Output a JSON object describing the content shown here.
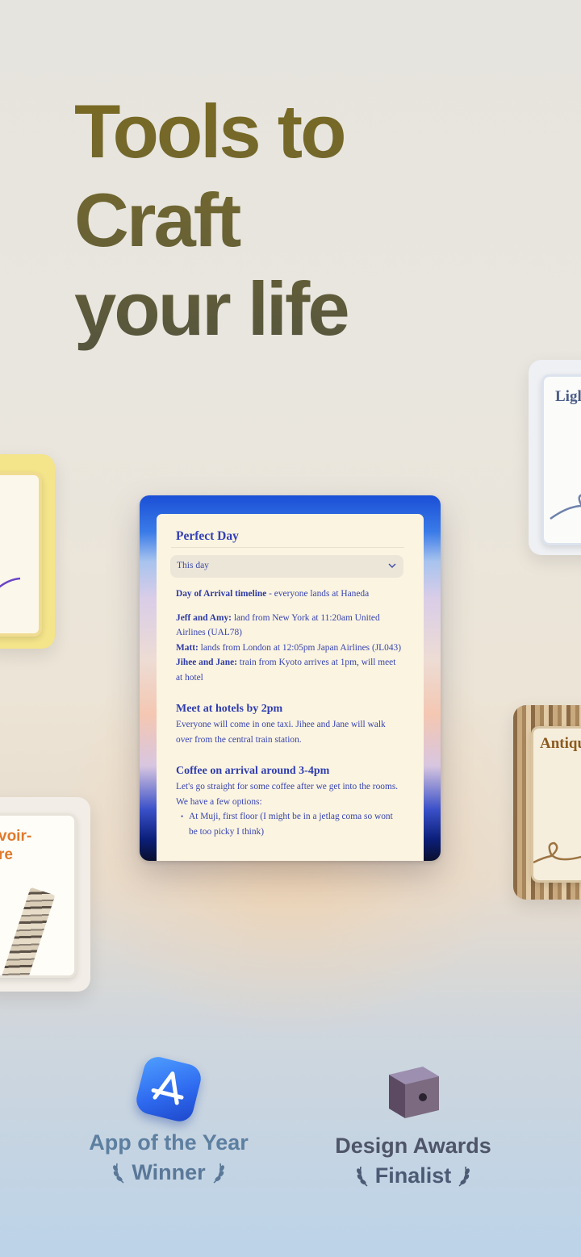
{
  "headline": {
    "line1": "Tools to",
    "line2": "Craft",
    "line3": "your life"
  },
  "side_cards": {
    "right_top_title": "Ligl",
    "left_bottom_title": "voir-\nre",
    "right_bottom_title": "Antiqu"
  },
  "document": {
    "title": "Perfect Day",
    "select_value": "This day",
    "timeline_heading": "Day of Arrival timeline",
    "timeline_rest": " - everyone lands at Haneda",
    "arrivals": [
      {
        "who": "Jeff and Amy:",
        "text": " land from New York at 11:20am United Airlines (UAL78)"
      },
      {
        "who": "Matt:",
        "text": " lands from London at 12:05pm Japan Airlines (JL043)"
      },
      {
        "who": "Jihee and Jane:",
        "text": " train from Kyoto arrives at 1pm, will meet at hotel"
      }
    ],
    "section1_heading": "Meet at hotels by 2pm",
    "section1_text": "Everyone will come in one taxi. Jihee and Jane will walk over from the central train station.",
    "section2_heading": "Coffee on arrival around 3-4pm",
    "section2_text": "Let's go straight for some coffee after we get into the rooms. We have a few options:",
    "section2_bullet": "At Muji, first floor (I might be in a jetlag coma so wont be too picky I think)"
  },
  "awards": [
    {
      "title": "App of the Year",
      "subtitle": "Winner",
      "icon": "app-store-icon"
    },
    {
      "title": "Design Awards",
      "subtitle": "Finalist",
      "icon": "apple-design-award-cube-icon"
    }
  ],
  "colors": {
    "headline_top": "#7a6a22",
    "headline_bottom": "#55553f",
    "doc_text": "#3343b8",
    "award_text": "#5d7fa0"
  }
}
